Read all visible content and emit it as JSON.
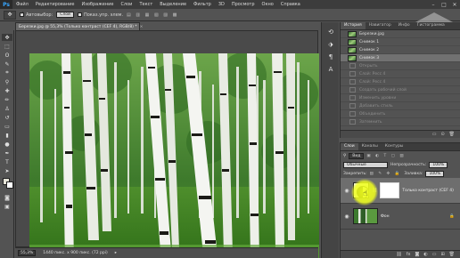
{
  "app": {
    "logo": "Ps"
  },
  "menu": [
    "Файл",
    "Редактирование",
    "Изображение",
    "Слои",
    "Текст",
    "Выделение",
    "Фильтр",
    "3D",
    "Просмотр",
    "Окно",
    "Справка"
  ],
  "window_controls": [
    "–",
    "□",
    "✕"
  ],
  "options": {
    "tool_icon": "move-tool",
    "autoselect_label": "Автовыбор:",
    "autoselect_value": "Слой",
    "transform_label": "Показ.упр. элем."
  },
  "document": {
    "tab_title": "Березки.jpg @ 55,3% (Только контраст (CEF 4), RGB/8) *",
    "tab_close": "×",
    "zoom": "55,3%",
    "dimensions": "1440 пикс. x 900 пикс. (72 ppi)"
  },
  "history": {
    "tabs": [
      "История",
      "Навигатор",
      "Инфо",
      "Гистограмма"
    ],
    "items": [
      {
        "label": "Березки.jpg",
        "state": "normal",
        "thumb": true
      },
      {
        "label": "Снимок 1",
        "state": "normal",
        "thumb": true
      },
      {
        "label": "Снимок 2",
        "state": "normal",
        "thumb": true
      },
      {
        "label": "Снимок 3",
        "state": "selected",
        "thumb": true
      },
      {
        "label": "Открыть",
        "state": "dim",
        "thumb": false
      },
      {
        "label": "Слой: Ресс 4",
        "state": "dim",
        "thumb": false
      },
      {
        "label": "Слой: Ресс 4",
        "state": "dim",
        "thumb": false
      },
      {
        "label": "Создать рабочий слой",
        "state": "dim",
        "thumb": false
      },
      {
        "label": "Изменить уровни",
        "state": "dim",
        "thumb": false
      },
      {
        "label": "Добавить стиль",
        "state": "dim",
        "thumb": false
      },
      {
        "label": "Объединить",
        "state": "dim",
        "thumb": false
      },
      {
        "label": "Затемнить",
        "state": "dim",
        "thumb": false
      }
    ]
  },
  "layers": {
    "tabs": [
      "Слои",
      "Каналы",
      "Контуры"
    ],
    "filter": "Вид",
    "blend_mode": "Обычные",
    "opacity_label": "Непрозрачность:",
    "opacity_value": "100%",
    "lock_label": "Закрепить:",
    "fill_label": "Заливка:",
    "fill_value": "100%",
    "items": [
      {
        "name": "Только контраст (CEF 4)",
        "selected": true,
        "kind": "adjustment"
      },
      {
        "name": "Фон",
        "selected": false,
        "kind": "photo"
      }
    ]
  },
  "watermark_text": "КОМПЬЮТЕРНАЯ ГРАМОТНОСТЬ",
  "colors": {
    "accent_blue": "#38a5ff",
    "highlight_yellow": "#f0ff1e",
    "panel_bg": "#535353",
    "menubar_bg": "#3c3c3c"
  }
}
